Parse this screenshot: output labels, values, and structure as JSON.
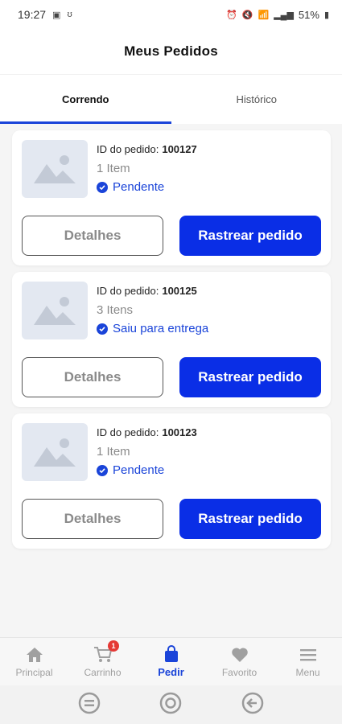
{
  "status_bar": {
    "time": "19:27",
    "network": "LTE1 LTE2",
    "battery": "51%"
  },
  "header": {
    "title": "Meus Pedidos"
  },
  "tabs": [
    {
      "label": "Correndo",
      "active": true
    },
    {
      "label": "Histórico",
      "active": false
    }
  ],
  "orders": [
    {
      "id_label": "ID do pedido:",
      "id": "100127",
      "items": "1 Item",
      "status": "Pendente",
      "details_label": "Detalhes",
      "track_label": "Rastrear pedido"
    },
    {
      "id_label": "ID do pedido:",
      "id": "100125",
      "items": "3 Itens",
      "status": "Saiu para entrega",
      "details_label": "Detalhes",
      "track_label": "Rastrear pedido"
    },
    {
      "id_label": "ID do pedido:",
      "id": "100123",
      "items": "1 Item",
      "status": "Pendente",
      "details_label": "Detalhes",
      "track_label": "Rastrear pedido"
    }
  ],
  "bottom_nav": [
    {
      "label": "Principal",
      "icon": "home-icon"
    },
    {
      "label": "Carrinho",
      "icon": "cart-icon",
      "badge": "1"
    },
    {
      "label": "Pedir",
      "icon": "shopping-bag-icon",
      "active": true
    },
    {
      "label": "Favorito",
      "icon": "heart-icon"
    },
    {
      "label": "Menu",
      "icon": "menu-icon"
    }
  ],
  "colors": {
    "accent": "#1a44d9",
    "primary_button": "#0a2ee6",
    "badge": "#e53935",
    "thumbnail_bg": "#e3e8f1"
  }
}
